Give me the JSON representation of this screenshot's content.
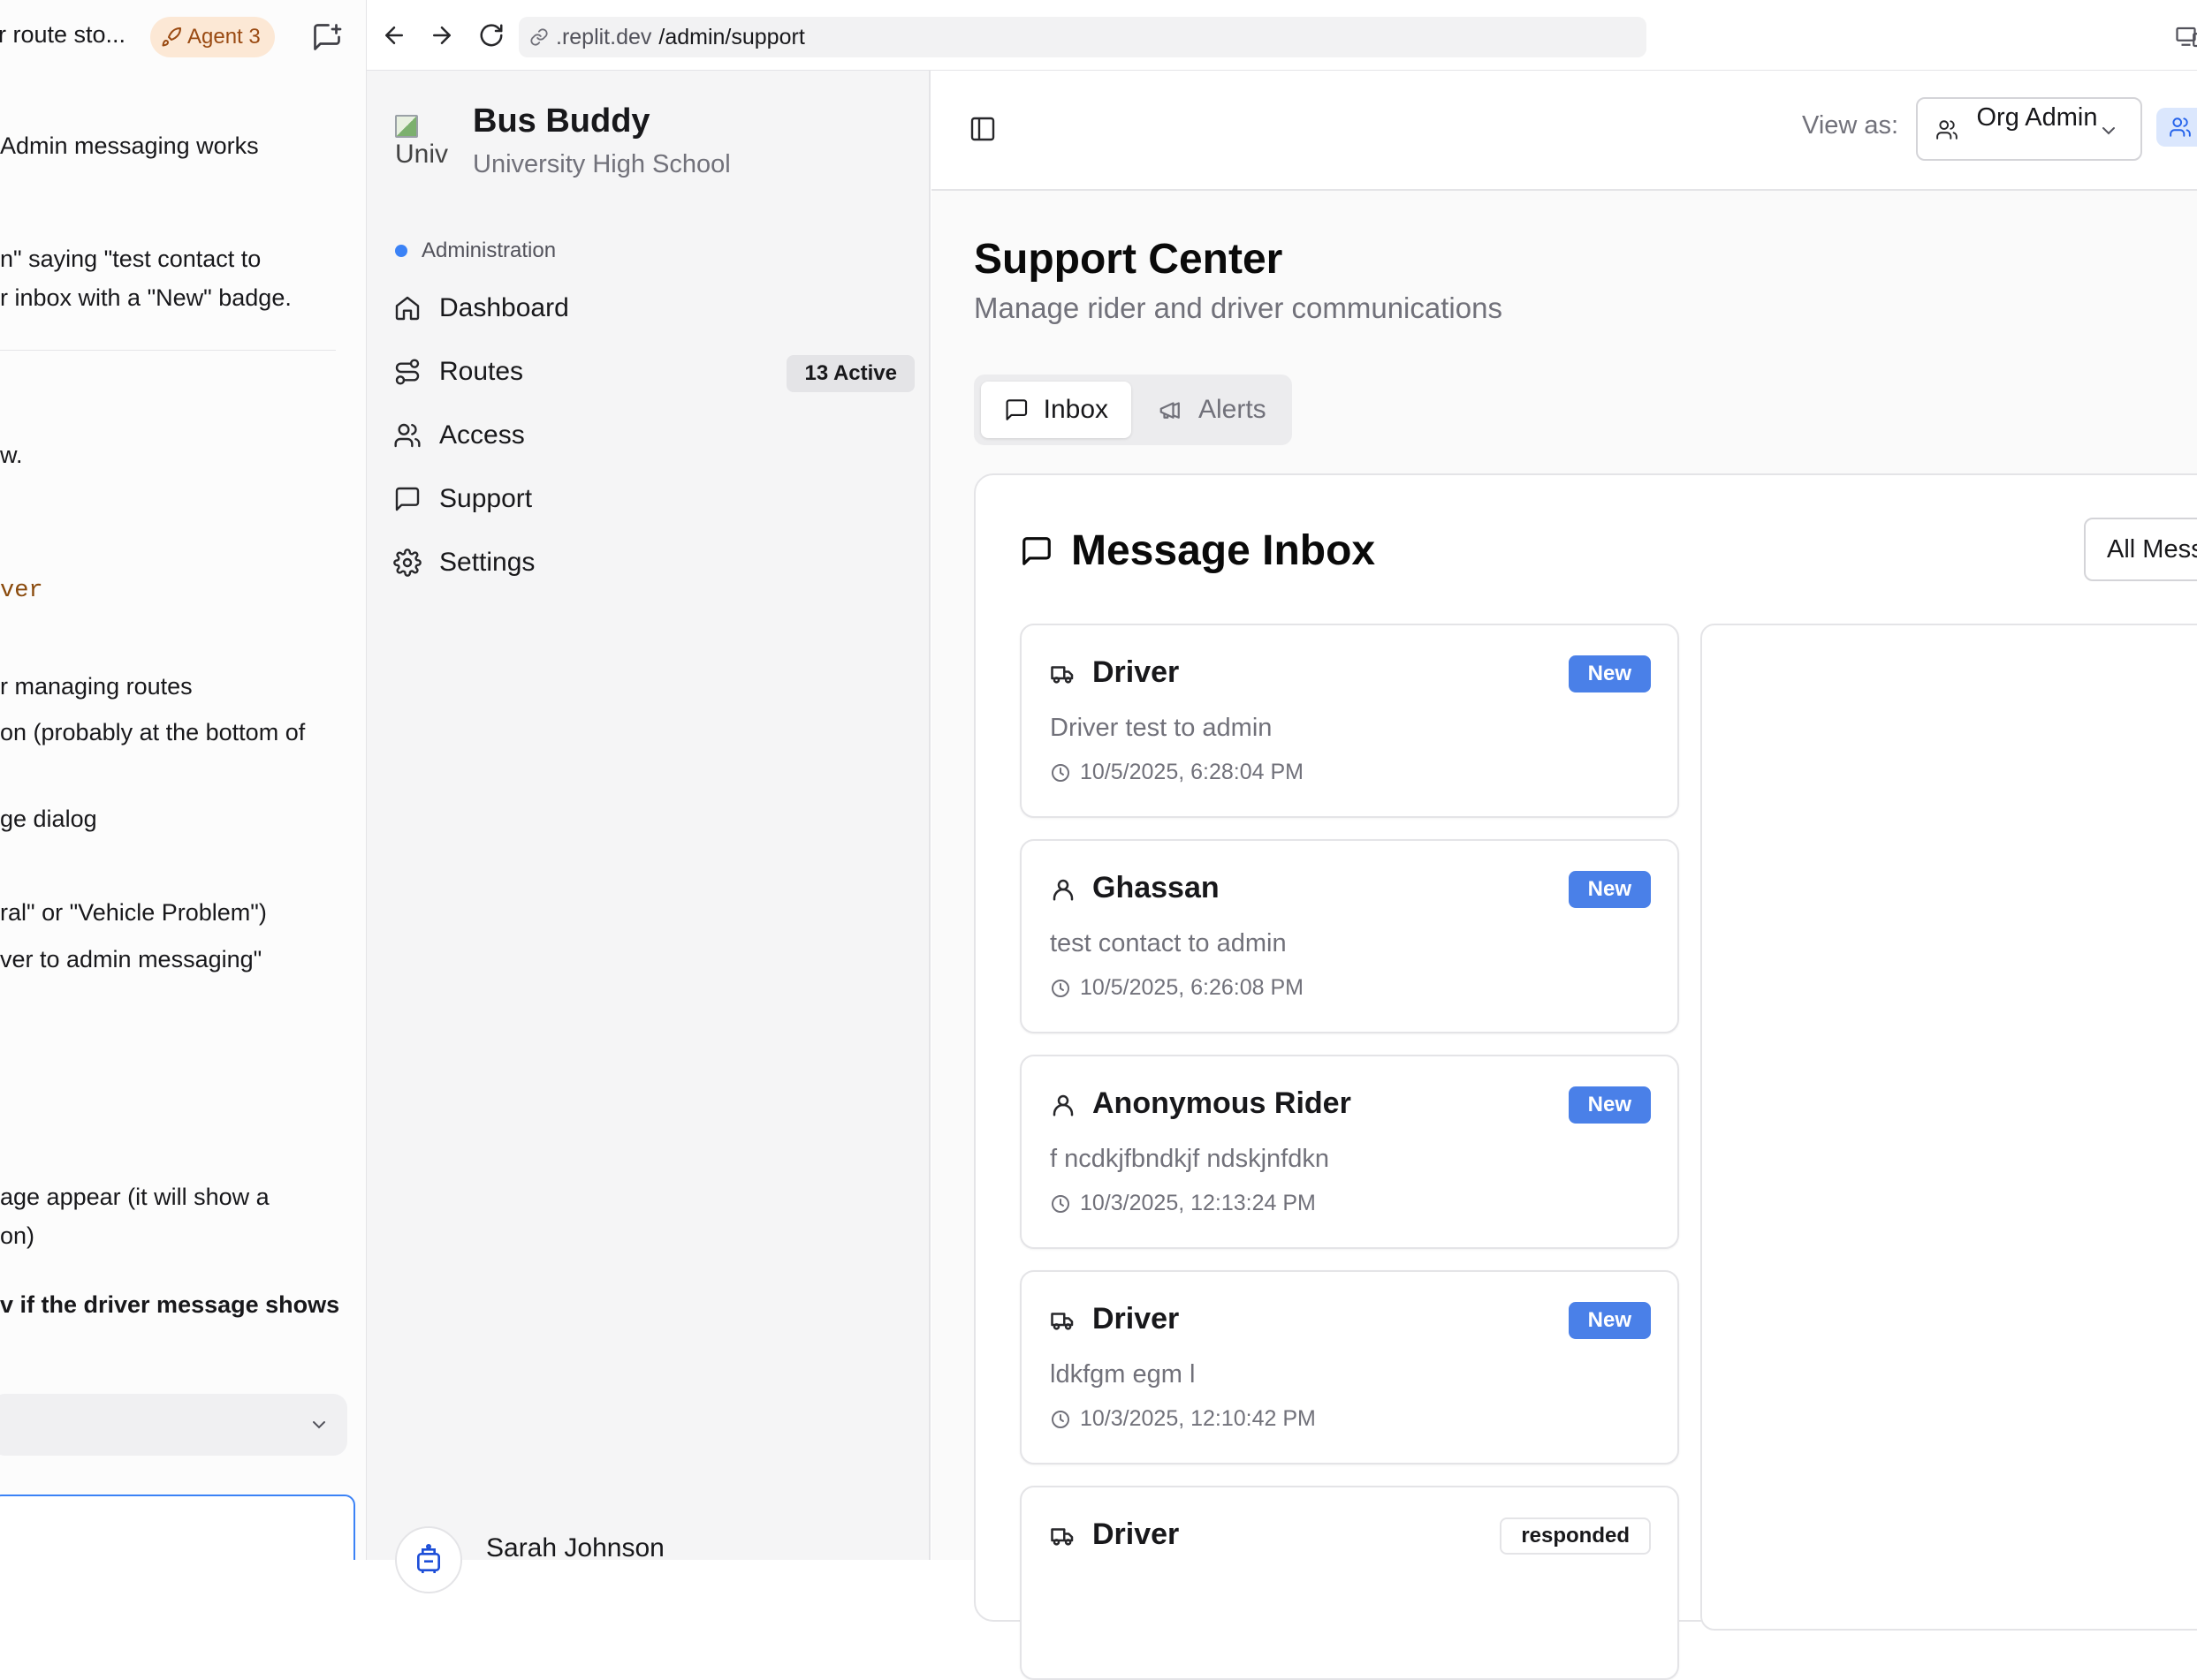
{
  "agent": {
    "title": "r route sto...",
    "badge": "Agent 3",
    "lines": [
      {
        "text": "Admin messaging works",
        "style": ""
      },
      {
        "text": "n\" saying \"test contact to",
        "style": ""
      },
      {
        "text": "r inbox with a \"New\" badge.",
        "style": ""
      },
      {
        "text": "w.",
        "style": ""
      },
      {
        "text": "ver",
        "style": "mono"
      },
      {
        "text": "r managing routes",
        "style": ""
      },
      {
        "text": "on (probably at the bottom of",
        "style": ""
      },
      {
        "text": "ge dialog",
        "style": ""
      },
      {
        "text": "ral\" or \"Vehicle Problem\")",
        "style": ""
      },
      {
        "text": "ver to admin messaging\"",
        "style": ""
      },
      {
        "text": "age appear (it will show a",
        "style": ""
      },
      {
        "text": "on)",
        "style": ""
      },
      {
        "text": "v if the driver message shows",
        "style": "bold"
      }
    ]
  },
  "browser": {
    "url_host": ".replit.dev",
    "url_path": "/admin/support"
  },
  "sidebar": {
    "logo_alt": "Univ",
    "app_name": "Bus Buddy",
    "org_name": "University High School",
    "section": "Administration",
    "items": [
      {
        "label": "Dashboard",
        "icon": "home-icon",
        "badge": ""
      },
      {
        "label": "Routes",
        "icon": "route-icon",
        "badge": "13 Active"
      },
      {
        "label": "Access",
        "icon": "users-icon",
        "badge": ""
      },
      {
        "label": "Support",
        "icon": "message-square-icon",
        "badge": ""
      },
      {
        "label": "Settings",
        "icon": "gear-icon",
        "badge": ""
      }
    ],
    "user_name": "Sarah Johnson"
  },
  "topbar": {
    "view_as_label": "View as:",
    "role_value": "Org Admin"
  },
  "page": {
    "title": "Support Center",
    "subtitle": "Manage rider and driver communications"
  },
  "tabs": [
    {
      "label": "Inbox",
      "icon": "message-square-icon",
      "active": true
    },
    {
      "label": "Alerts",
      "icon": "megaphone-icon",
      "active": false
    }
  ],
  "inbox": {
    "heading": "Message Inbox",
    "filter_value": "All Mess",
    "messages": [
      {
        "sender": "Driver",
        "type": "truck-icon",
        "body": "Driver test to admin",
        "time": "10/5/2025, 6:28:04 PM",
        "status": "New"
      },
      {
        "sender": "Ghassan",
        "type": "user-icon",
        "body": "test contact to admin",
        "time": "10/5/2025, 6:26:08 PM",
        "status": "New"
      },
      {
        "sender": "Anonymous Rider",
        "type": "user-icon",
        "body": "f ncdkjfbndkjf ndskjnfdkn",
        "time": "10/3/2025, 12:13:24 PM",
        "status": "New"
      },
      {
        "sender": "Driver",
        "type": "truck-icon",
        "body": "ldkfgm egm l",
        "time": "10/3/2025, 12:10:42 PM",
        "status": "New"
      },
      {
        "sender": "Driver",
        "type": "truck-icon",
        "body": "",
        "time": "",
        "status": "responded"
      }
    ]
  }
}
